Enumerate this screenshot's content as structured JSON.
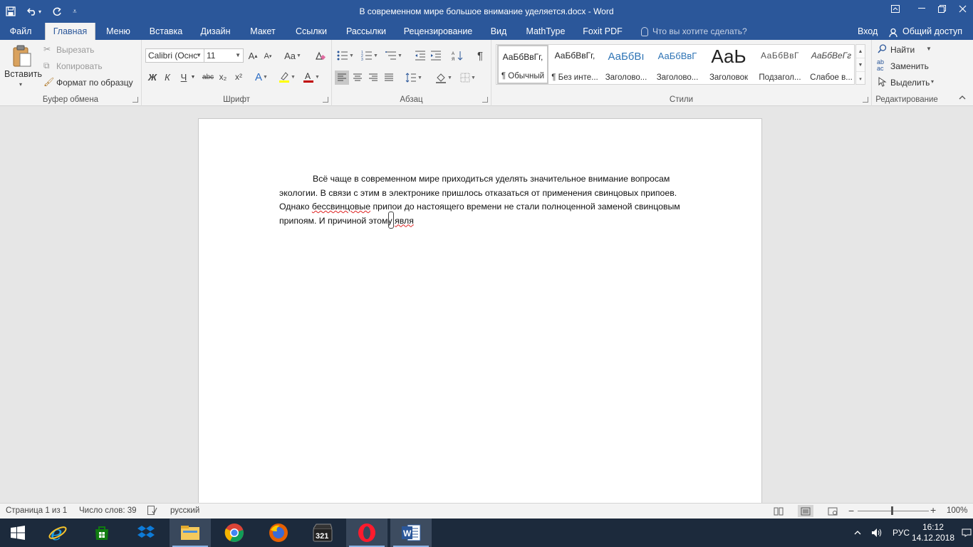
{
  "window": {
    "title": "В современном мире большое внимание уделяется.docx - Word"
  },
  "qat": {
    "save": "save-icon",
    "undo": "undo-icon",
    "redo": "redo-icon"
  },
  "tabs": [
    {
      "label": "Файл",
      "active": false
    },
    {
      "label": "Главная",
      "active": true
    },
    {
      "label": "Меню",
      "active": false
    },
    {
      "label": "Вставка",
      "active": false
    },
    {
      "label": "Дизайн",
      "active": false
    },
    {
      "label": "Макет",
      "active": false
    },
    {
      "label": "Ссылки",
      "active": false
    },
    {
      "label": "Рассылки",
      "active": false
    },
    {
      "label": "Рецензирование",
      "active": false
    },
    {
      "label": "Вид",
      "active": false
    },
    {
      "label": "MathType",
      "active": false
    },
    {
      "label": "Foxit PDF",
      "active": false
    }
  ],
  "tell_me": "Что вы хотите сделать?",
  "sign_in": "Вход",
  "share": "Общий доступ",
  "clipboard": {
    "paste": "Вставить",
    "cut": "Вырезать",
    "copy": "Копировать",
    "format_painter": "Формат по образцу",
    "label": "Буфер обмена"
  },
  "font": {
    "name": "Calibri (Оснс",
    "size": "11",
    "bold": "Ж",
    "italic": "К",
    "underline": "Ч",
    "strike": "abc",
    "sub": "x₂",
    "sup": "x²",
    "case": "Aa",
    "label": "Шрифт"
  },
  "paragraph": {
    "label": "Абзац",
    "pilcrow": "¶"
  },
  "styles": {
    "label": "Стили",
    "items": [
      {
        "sample": "АаБбВвГг,",
        "name": "¶ Обычный"
      },
      {
        "sample": "АаБбВвГг,",
        "name": "¶ Без инте..."
      },
      {
        "sample": "АаБбВı",
        "name": "Заголово..."
      },
      {
        "sample": "АаБбВвГ",
        "name": "Заголово..."
      },
      {
        "sample": "АаЬ",
        "name": "Заголовок"
      },
      {
        "sample": "АаБбВвГ",
        "name": "Подзагол..."
      },
      {
        "sample": "АаБбВеГг",
        "name": "Слабое в..."
      }
    ]
  },
  "editing": {
    "find": "Найти",
    "replace": "Заменить",
    "select": "Выделить",
    "label": "Редактирование"
  },
  "document": {
    "line1": "Всё чаще в современном мире приходиться уделять значительное внимание вопросам",
    "line2": "экологии. В связи с этим в электронике пришлось отказаться от применения свинцовых припоев.",
    "line3_a": "Однако ",
    "line3_b": "бессвинцовые",
    "line3_c": " припои до настоящего времени не стали полноценной заменой свинцовым",
    "line4_a": "припоям. И причиной этому ",
    "line4_b": "явля"
  },
  "status": {
    "page": "Страница 1 из 1",
    "words": "Число слов: 39",
    "language": "русский",
    "zoom": "100%",
    "zoom_level": 1.0
  },
  "taskbar": {
    "apps": [
      "start-icon",
      "ie-icon",
      "store-icon",
      "dropbox-icon",
      "explorer-icon",
      "chrome-icon",
      "firefox-icon",
      "media-player-icon",
      "opera-icon",
      "word-icon"
    ],
    "lang": "РУС",
    "time": "16:12",
    "date": "14.12.2018"
  },
  "colors": {
    "accent": "#2b579a",
    "taskbar": "#1c2a3c",
    "squiggle": "#dd2222",
    "font_color": "#c00000",
    "highlight": "#ffff00"
  }
}
